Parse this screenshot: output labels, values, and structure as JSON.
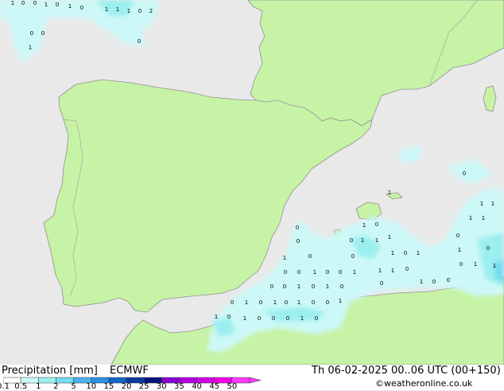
{
  "map": {
    "colors": {
      "sea": "#e9e9e9",
      "land": "#c6f3a5",
      "coast": "#909090",
      "dot": "#000000"
    },
    "precip_markers": [
      {
        "v": "1"
      },
      {
        "v": "0"
      },
      {
        "v": "0"
      },
      {
        "v": "1"
      },
      {
        "v": "0"
      },
      {
        "v": "1"
      },
      {
        "v": "0"
      },
      {
        "v": "1"
      },
      {
        "v": "1"
      },
      {
        "v": "1"
      },
      {
        "v": "0"
      },
      {
        "v": "2"
      },
      {
        "v": "0"
      },
      {
        "v": "0"
      },
      {
        "v": "1"
      },
      {
        "v": "0"
      },
      {
        "v": "0"
      },
      {
        "v": "1"
      },
      {
        "v": "0"
      },
      {
        "v": "0"
      },
      {
        "v": "1"
      },
      {
        "v": "0"
      },
      {
        "v": "1"
      },
      {
        "v": "0"
      },
      {
        "v": "1"
      },
      {
        "v": "1"
      },
      {
        "v": "0"
      },
      {
        "v": "1"
      },
      {
        "v": "0"
      },
      {
        "v": "1"
      },
      {
        "v": "0"
      },
      {
        "v": "1"
      },
      {
        "v": "0"
      },
      {
        "v": "0"
      },
      {
        "v": "1"
      },
      {
        "v": "0"
      },
      {
        "v": "0"
      },
      {
        "v": "1"
      },
      {
        "v": "1"
      },
      {
        "v": "1"
      },
      {
        "v": "0"
      },
      {
        "v": "1"
      },
      {
        "v": "1"
      },
      {
        "v": "1"
      },
      {
        "v": "1"
      },
      {
        "v": "0"
      },
      {
        "v": "1"
      },
      {
        "v": "0"
      },
      {
        "v": "0"
      },
      {
        "v": "1"
      },
      {
        "v": "1"
      },
      {
        "v": "0"
      },
      {
        "v": "1"
      },
      {
        "v": "0"
      },
      {
        "v": "0"
      },
      {
        "v": "0"
      },
      {
        "v": "0"
      },
      {
        "v": "1"
      },
      {
        "v": "0"
      },
      {
        "v": "1"
      },
      {
        "v": "0"
      },
      {
        "v": "0"
      },
      {
        "v": "1"
      },
      {
        "v": "0"
      },
      {
        "v": "1"
      },
      {
        "v": "0"
      },
      {
        "v": "1"
      },
      {
        "v": "0"
      },
      {
        "v": "0"
      },
      {
        "v": "1"
      },
      {
        "v": "1"
      },
      {
        "v": "0"
      },
      {
        "v": "1"
      },
      {
        "v": "0"
      },
      {
        "v": "0"
      },
      {
        "v": "0"
      },
      {
        "v": "1"
      },
      {
        "v": "0"
      }
    ]
  },
  "footer": {
    "title": "Precipitation [mm]",
    "model": "ECMWF",
    "valid_time": "Th 06-02-2025 00..06 UTC (00+150)",
    "credit": "©weatheronline.co.uk",
    "legend": {
      "ticks": [
        "0.1",
        "0.5",
        "1",
        "2",
        "5",
        "10",
        "15",
        "20",
        "25",
        "30",
        "35",
        "40",
        "45",
        "50"
      ],
      "colors": [
        "#ffffff",
        "#cdf8f8",
        "#9cefef",
        "#74dcf3",
        "#4ab3f0",
        "#2a8ee6",
        "#1565c9",
        "#0a3aa0",
        "#06157a",
        "#8a00d6",
        "#b100e0",
        "#d300e6",
        "#f200e8",
        "#ff38ff"
      ]
    }
  }
}
